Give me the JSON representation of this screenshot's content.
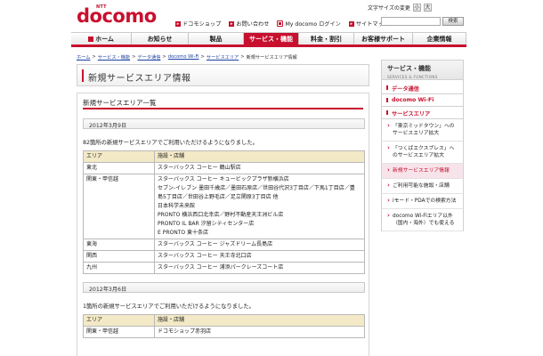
{
  "header": {
    "logo_small": "NTT",
    "logo": "docomo",
    "textsize_label": "文字サイズの変更",
    "textsize_small": "小",
    "textsize_large": "大",
    "search_button": "検索",
    "links": [
      {
        "label": "ドコモショップ",
        "icon": "square-icon"
      },
      {
        "label": "お問い合わせ",
        "icon": "square-icon"
      },
      {
        "label": "My docomo ログイン",
        "icon": "phone-icon"
      },
      {
        "label": "サイトマップ",
        "icon": "square-icon"
      }
    ]
  },
  "nav": {
    "tabs": [
      {
        "label": "ホーム"
      },
      {
        "label": "お知らせ"
      },
      {
        "label": "製品"
      },
      {
        "label": "サービス・機能"
      },
      {
        "label": "料金・割引"
      },
      {
        "label": "お客様サポート"
      },
      {
        "label": "企業情報"
      }
    ],
    "active_color": "#c8102e"
  },
  "breadcrumb": {
    "items": [
      "ホーム",
      "サービス・機能",
      "データ通信",
      "docomo Wi-Fi",
      "サービスエリア"
    ],
    "current": "新規サービスエリア情報",
    "separator": ">"
  },
  "page": {
    "title": "新規サービスエリア情報",
    "section_title": "新規サービスエリア一覧"
  },
  "updates": [
    {
      "date": "2012年3月9日",
      "intro": "82箇所の新規サービスエリアでご利用いただけるようになりました。",
      "table": {
        "headers": [
          "エリア",
          "施設・店舗"
        ],
        "rows": [
          {
            "area": "東北",
            "lines": [
              "スターバックス コーヒー 鶴山駅店"
            ]
          },
          {
            "area": "関東・甲信越",
            "lines": [
              "スターバックス コーヒー キュービックプラザ新横浜店",
              "セブン-イレブン 墨田千歳店／墨田石原店／世田谷代沢3丁目店／下馬1丁目店／豊",
              "島5丁目店／世田谷上野毛店／足立関原3丁目店 他",
              "日本科学未来館",
              "PRONTO 横浜西口北幸店／野村不動産天王洲ビル店",
              "PRONTO IL BAR 汐留シティセンター店",
              "E PRONTO 東十条店"
            ]
          },
          {
            "area": "東海",
            "lines": [
              "スターバックス コーヒー ジャズドリーム長島店"
            ]
          },
          {
            "area": "関西",
            "lines": [
              "スターバックス コーヒー 天王寺北口店"
            ]
          },
          {
            "area": "九州",
            "lines": [
              "スターバックス コーヒー 浦添パークレーズコート店"
            ]
          }
        ]
      }
    },
    {
      "date": "2012年3月6日",
      "intro": "1箇所の新規サービスエリアでご利用いただけるようになりました。",
      "table": {
        "headers": [
          "エリア",
          "施設・店舗"
        ],
        "rows": [
          {
            "area": "関東・甲信越",
            "lines": [
              "ドコモショップ赤羽店"
            ]
          }
        ]
      }
    }
  ],
  "sidebar": {
    "title": "サービス・機能",
    "title_en": "SERVICES & FUNCTIONS",
    "items": [
      "データ通信",
      "docomo Wi-Fi",
      "サービスエリア"
    ],
    "subitems": [
      {
        "label": "「東京ミッドタウン」へのサービスエリア拡大"
      },
      {
        "label": "「つくばエクスプレス」へのサービスエリア拡大"
      },
      {
        "label": "新規サービスエリア情報",
        "selected": true
      },
      {
        "label": "ご利用可能な施設・店舗"
      },
      {
        "label": "iモード・PDAでの検索方法"
      },
      {
        "label": "docomo Wi-Fiエリア以外（国内・海外）でも使える"
      }
    ]
  }
}
